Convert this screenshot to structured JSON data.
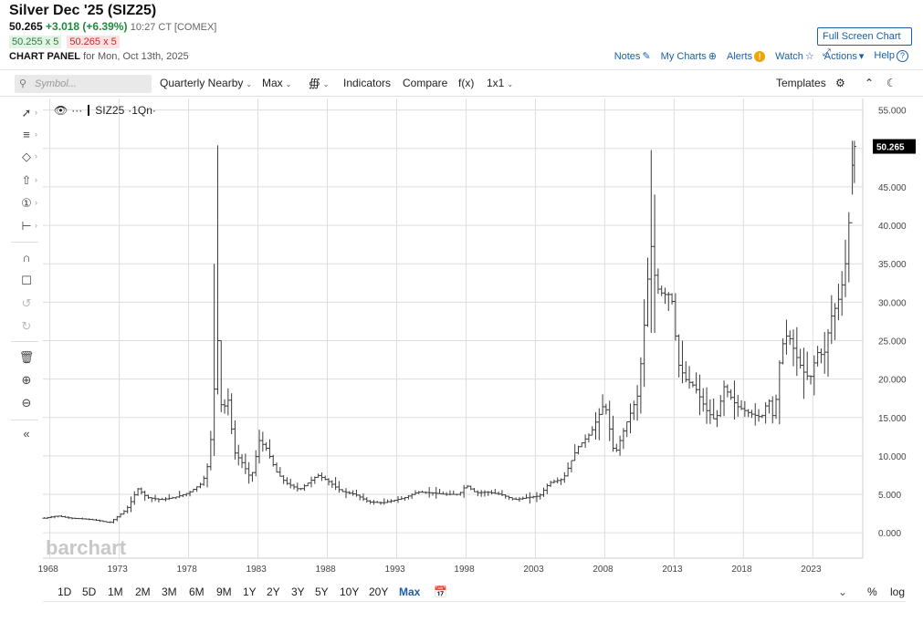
{
  "header": {
    "title": "Silver Dec '25 (SIZ25)",
    "last": "50.265",
    "change": "+3.018 (+6.39%)",
    "time": "10:27 CT [COMEX]",
    "bid": "50.255 x 5",
    "ask": "50.265 x 5",
    "panel_label": "CHART PANEL",
    "panel_date": "for Mon, Oct 13th, 2025",
    "fullscreen_label": "Full Screen Chart",
    "links": {
      "notes": "Notes",
      "mycharts": "My Charts",
      "alerts": "Alerts",
      "watch": "Watch",
      "actions": "Actions",
      "help": "Help"
    }
  },
  "toolbar": {
    "search_placeholder": "Symbol...",
    "period": "Quarterly Nearby",
    "range": "Max",
    "indicators": "Indicators",
    "compare": "Compare",
    "fx": "f(x)",
    "layout": "1x1",
    "templates": "Templates"
  },
  "legend": {
    "symbol": "SIZ25",
    "suffix": "·1Qn·"
  },
  "watermark": "barchart",
  "price_label": "50.265",
  "range_buttons": [
    "1D",
    "5D",
    "1M",
    "2M",
    "3M",
    "6M",
    "9M",
    "1Y",
    "2Y",
    "3Y",
    "5Y",
    "10Y",
    "20Y",
    "Max"
  ],
  "active_range": "Max",
  "bottom_right": {
    "percent": "%",
    "log": "log"
  },
  "colors": {
    "bar": "#3a3a3a",
    "grid": "#dddddd",
    "last_price_bg": "#000000",
    "link": "#1a5fa8",
    "up": "#1e8a3c"
  },
  "chart_data": {
    "type": "ohlc",
    "title": "Silver Dec '25 (SIZ25)",
    "interval": "Quarterly Nearby",
    "x_tick_labels": [
      "1968",
      "1973",
      "1978",
      "1983",
      "1988",
      "1993",
      "1998",
      "2003",
      "2008",
      "2013",
      "2018",
      "2023"
    ],
    "y_tick_labels": [
      "0.000",
      "5.000",
      "10.000",
      "15.000",
      "20.000",
      "25.000",
      "30.000",
      "35.000",
      "40.000",
      "45.000",
      "50.000",
      "55.000"
    ],
    "ylim": [
      -3.3,
      56.5
    ],
    "xlim": [
      1967.5,
      2026.6
    ],
    "grid": true,
    "last_price": 50.265,
    "anchors": [
      [
        1967.6,
        1.9
      ],
      [
        1968.5,
        2.2
      ],
      [
        1969.5,
        1.9
      ],
      [
        1970.5,
        1.8
      ],
      [
        1971.5,
        1.6
      ],
      [
        1972.3,
        1.3
      ],
      [
        1972.8,
        2.0
      ],
      [
        1973.5,
        3.0
      ],
      [
        1974.0,
        4.5
      ],
      [
        1974.3,
        5.8
      ],
      [
        1975.0,
        4.6
      ],
      [
        1976.0,
        4.3
      ],
      [
        1977.0,
        4.6
      ],
      [
        1978.0,
        5.2
      ],
      [
        1979.0,
        6.5
      ],
      [
        1979.5,
        9.5
      ],
      [
        1979.9,
        20.0
      ],
      [
        1980.1,
        25.0
      ],
      [
        1980.4,
        15.0
      ],
      [
        1980.8,
        18.0
      ],
      [
        1981.3,
        10.5
      ],
      [
        1981.9,
        9.0
      ],
      [
        1982.5,
        7.0
      ],
      [
        1983.1,
        12.0
      ],
      [
        1983.6,
        11.0
      ],
      [
        1984.3,
        8.0
      ],
      [
        1985.0,
        6.5
      ],
      [
        1986.0,
        5.6
      ],
      [
        1987.3,
        7.5
      ],
      [
        1988.0,
        6.8
      ],
      [
        1989.0,
        5.4
      ],
      [
        1990.0,
        5.0
      ],
      [
        1991.0,
        4.0
      ],
      [
        1992.0,
        3.9
      ],
      [
        1993.5,
        4.5
      ],
      [
        1994.5,
        5.3
      ],
      [
        1995.5,
        5.2
      ],
      [
        1996.5,
        5.0
      ],
      [
        1997.5,
        5.0
      ],
      [
        1998.0,
        6.2
      ],
      [
        1998.7,
        5.2
      ],
      [
        1999.5,
        5.3
      ],
      [
        2000.5,
        5.0
      ],
      [
        2001.5,
        4.3
      ],
      [
        2002.5,
        4.6
      ],
      [
        2003.3,
        4.8
      ],
      [
        2004.0,
        6.5
      ],
      [
        2005.0,
        7.0
      ],
      [
        2006.0,
        11.0
      ],
      [
        2007.0,
        13.0
      ],
      [
        2008.0,
        17.0
      ],
      [
        2008.7,
        10.0
      ],
      [
        2009.5,
        14.0
      ],
      [
        2010.4,
        18.0
      ],
      [
        2010.9,
        28.0
      ],
      [
        2011.3,
        38.0
      ],
      [
        2011.7,
        32.0
      ],
      [
        2012.2,
        31.0
      ],
      [
        2012.8,
        31.0
      ],
      [
        2013.3,
        22.0
      ],
      [
        2013.8,
        20.0
      ],
      [
        2014.5,
        19.0
      ],
      [
        2015.3,
        16.0
      ],
      [
        2016.0,
        14.5
      ],
      [
        2016.6,
        19.0
      ],
      [
        2017.5,
        16.5
      ],
      [
        2018.5,
        15.5
      ],
      [
        2019.3,
        15.0
      ],
      [
        2019.8,
        17.5
      ],
      [
        2020.2,
        14.5
      ],
      [
        2020.7,
        24.0
      ],
      [
        2021.2,
        26.0
      ],
      [
        2021.8,
        23.0
      ],
      [
        2022.3,
        21.0
      ],
      [
        2022.8,
        20.0
      ],
      [
        2023.3,
        23.5
      ],
      [
        2023.8,
        23.0
      ],
      [
        2024.3,
        28.0
      ],
      [
        2024.8,
        30.0
      ],
      [
        2025.2,
        33.0
      ],
      [
        2025.5,
        37.0
      ],
      [
        2025.8,
        47.0
      ],
      [
        2026.0,
        50.265
      ]
    ],
    "spikes": [
      {
        "x": 1980.0,
        "high": 50.4,
        "low": 18.0
      },
      {
        "x": 1979.75,
        "high": 35.0,
        "low": 10.0
      },
      {
        "x": 2011.25,
        "high": 49.8,
        "low": 26.0
      },
      {
        "x": 2011.5,
        "high": 44.0,
        "low": 26.0
      },
      {
        "x": 2025.75,
        "high": 51.0,
        "low": 44.0
      }
    ]
  }
}
